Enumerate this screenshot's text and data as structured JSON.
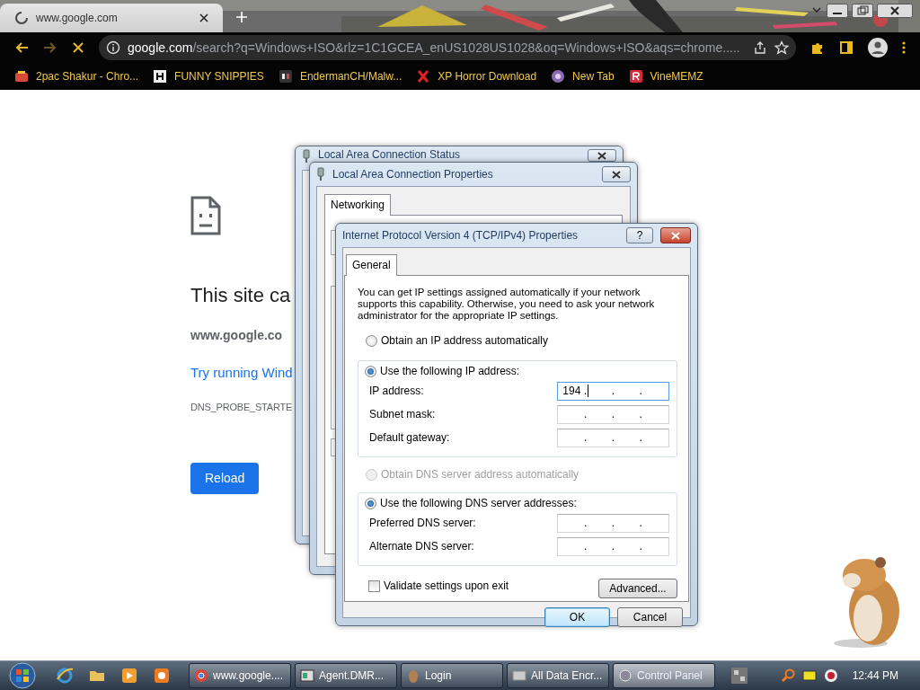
{
  "browser": {
    "tab": {
      "title": "www.google.com",
      "loading": true,
      "selected": true
    },
    "address": {
      "host": "google.com",
      "path": "/search?q=Windows+ISO&rlz=1C1GCEA_enUS1028US1028&oq=Windows+ISO&aqs=chrome....."
    },
    "navigation": {
      "back_enabled": true,
      "forward_enabled": false,
      "loading": true
    },
    "bookmarks": [
      {
        "label": "2pac Shakur - Chro..."
      },
      {
        "label": "FUNNY SNIPPIES"
      },
      {
        "label": "EndermanCH/Malw..."
      },
      {
        "label": "XP Horror Download"
      },
      {
        "label": "New Tab"
      },
      {
        "label": "VineMEMZ"
      }
    ]
  },
  "error_page": {
    "heading": "This site ca",
    "host": "www.google.co",
    "suggestion": "Try running Wind",
    "code": "DNS_PROBE_STARTE",
    "reload": "Reload"
  },
  "status_window": {
    "title": "Local Area Connection Status"
  },
  "properties_window": {
    "title": "Local Area Connection Properties",
    "tabs": [
      {
        "label": "Networking",
        "selected": true
      }
    ]
  },
  "ipv4_dialog": {
    "title": "Internet Protocol Version 4 (TCP/IPv4) Properties",
    "help": "?",
    "tabs": [
      {
        "label": "General",
        "selected": true
      }
    ],
    "intro": "You can get IP settings assigned automatically if your network supports this capability. Otherwise, you need to ask your network administrator for the appropriate IP settings.",
    "ip_auto": {
      "label": "Obtain an IP address automatically",
      "selected": false,
      "disabled": false
    },
    "ip_manual": {
      "label": "Use the following IP address:",
      "selected": true,
      "disabled": false
    },
    "ip_fields": [
      {
        "label": "IP address:",
        "value": "194",
        "dots": [
          ".",
          ".",
          "."
        ],
        "focused": true
      },
      {
        "label": "Subnet mask:",
        "dots": [
          ".",
          ".",
          "."
        ],
        "focused": false
      },
      {
        "label": "Default gateway:",
        "dots": [
          ".",
          ".",
          "."
        ],
        "focused": false
      }
    ],
    "dns_auto": {
      "label": "Obtain DNS server address automatically",
      "selected": false,
      "disabled": true
    },
    "dns_manual": {
      "label": "Use the following DNS server addresses:",
      "selected": true,
      "disabled": false
    },
    "dns_fields": [
      {
        "label": "Preferred DNS server:",
        "dots": [
          ".",
          ".",
          "."
        ],
        "focused": false
      },
      {
        "label": "Alternate DNS server:",
        "dots": [
          ".",
          ".",
          "."
        ],
        "focused": false
      }
    ],
    "validate": {
      "label": "Validate settings upon exit",
      "checked": false
    },
    "advanced": "Advanced...",
    "buttons": [
      {
        "label": "OK",
        "default": true
      },
      {
        "label": "Cancel",
        "default": false
      }
    ]
  },
  "taskbar": {
    "tasks": [
      {
        "label": "www.google....",
        "active": false
      },
      {
        "label": "Agent.DMR...",
        "active": false
      },
      {
        "label": "Login",
        "active": false
      },
      {
        "label": "All Data Encr...",
        "active": false
      },
      {
        "label": "Control Panel",
        "active": true
      }
    ],
    "clock": "12:44 PM"
  }
}
